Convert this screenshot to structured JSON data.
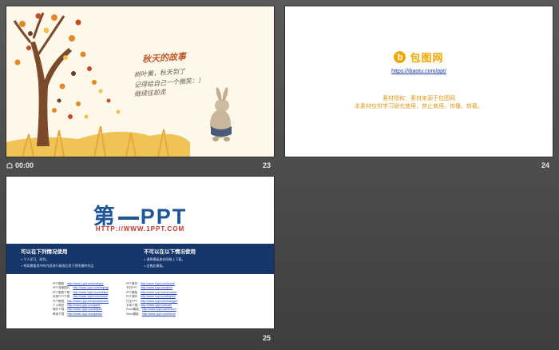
{
  "slides": [
    {
      "number": "23",
      "timer": "00:00",
      "handwriting": {
        "title": "秋天的故事",
        "lines": [
          "树叶黄，秋天到了",
          "记得给自己一个微笑：）",
          "继续往前走"
        ]
      }
    },
    {
      "number": "24",
      "logo_badge": "b",
      "logo_text": "包图网",
      "link": "https://ibaotu.com/ppt/",
      "note_line1": "素材授权：素材来源于包图网",
      "note_line2": "本素材仅供学习研究使用，禁止商用、传播、转载。"
    },
    {
      "number": "25",
      "title_left": "第",
      "title_right": "PPT",
      "url": "HTTP://WWW.1PPT.COM",
      "left_col": {
        "heading": "可以在下列情况使用",
        "items": [
          "个人学习、研究。",
          "将其需要用中的内容进行修改后用于您所需的作品"
        ]
      },
      "right_col": {
        "heading": "不可以在以下情况使用",
        "items": [
          "请将模板放在网络上下载。",
          "出售此模板。"
        ]
      },
      "links_left": [
        [
          "PPT模板",
          "http://www.1ppt.com/moban/"
        ],
        [
          "PPT背景图片",
          "http://www.1ppt.com/beijing/"
        ],
        [
          "PPT图表下载",
          "http://www.1ppt.com/tubiao/"
        ],
        [
          "优秀PPT下载",
          "http://www.1ppt.com/xiazai/"
        ],
        [
          "PPT教程",
          "http://www.1ppt.com/powerpoint/"
        ],
        [
          "个人简历",
          "http://www.1ppt.com/jianli/"
        ],
        [
          "课件下载",
          "http://www.1ppt.com/kejian/"
        ],
        [
          "教案下载",
          "http://www.1ppt.com/jiaoan/"
        ]
      ],
      "links_right": [
        [
          "PPT素材",
          "http://www.1ppt.com/sucai/"
        ],
        [
          "节日PPT",
          "http://www.1ppt.com/jieri/"
        ],
        [
          "PPT模板",
          "http://www.1ppt.com/moban/"
        ],
        [
          "PPT课件",
          "http://www.1ppt.com/kejian/"
        ],
        [
          "行业PPT",
          "http://www.1ppt.com/hangye/"
        ],
        [
          "字体下载",
          "http://www.1ppt.com/ziti/"
        ],
        [
          "Excel模板",
          "http://www.1ppt.com/excel/"
        ],
        [
          "Word模板",
          "http://www.1ppt.com/word/"
        ]
      ]
    }
  ],
  "colors": {
    "background": "#4a4a4a",
    "accent_blue": "#1e5596",
    "banner_navy": "#15366a",
    "brand_orange": "#f0a800",
    "url_red": "#c8362b"
  }
}
